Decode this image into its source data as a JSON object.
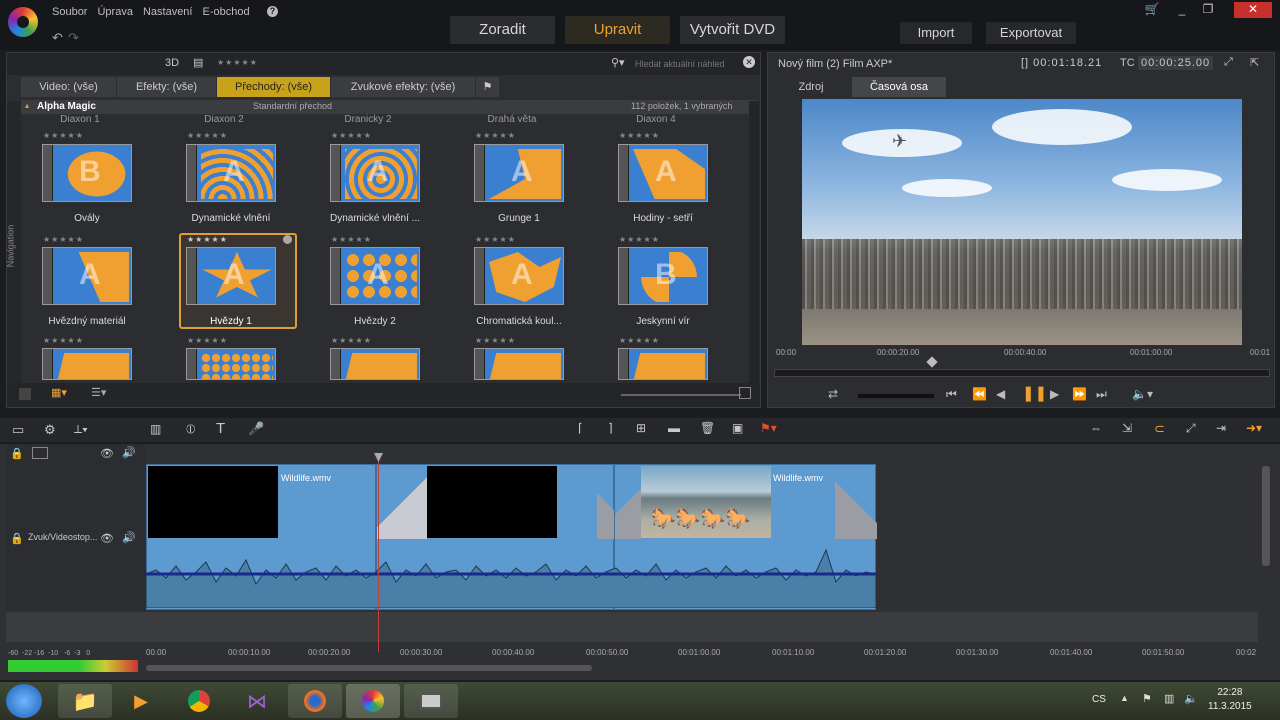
{
  "menu": {
    "items": [
      "Soubor",
      "Úprava",
      "Nastavení",
      "E-obchod"
    ]
  },
  "mode_tabs": [
    "Zoradit",
    "Upravit",
    "Vytvořit DVD"
  ],
  "actions": {
    "import": "Import",
    "export": "Exportovat"
  },
  "library": {
    "view_3d": "3D",
    "search_placeholder": "Hledat aktuální náhled",
    "filter_tabs": [
      "Video: (vše)",
      "Efekty: (vše)",
      "Přechody: (vše)",
      "Zvukové efekty: (vše)"
    ],
    "navigation_label": "Navigation",
    "group_name": "Alpha Magic",
    "group_note": "Standardní přechod",
    "group_count": "112 položek, 1 vybraných",
    "top_row_labels": [
      "Diaxon 1",
      "Diaxon 2",
      "Dranicky 2",
      "Drahá věta",
      "Diaxon 4"
    ],
    "items": [
      {
        "label": "Ovály",
        "glyph": "B"
      },
      {
        "label": "Dynamické vlnění",
        "glyph": "A"
      },
      {
        "label": "Dynamické vlnění ...",
        "glyph": "A"
      },
      {
        "label": "Grunge 1",
        "glyph": "A"
      },
      {
        "label": "Hodiny - setří",
        "glyph": "A"
      },
      {
        "label": "Hvězdný materiál",
        "glyph": "A"
      },
      {
        "label": "Hvězdy 1",
        "glyph": "A"
      },
      {
        "label": "Hvězdy 2",
        "glyph": "A"
      },
      {
        "label": "Chromatická koul...",
        "glyph": "A"
      },
      {
        "label": "Jeskynní vír",
        "glyph": "B"
      }
    ]
  },
  "player": {
    "title": "Nový film (2) Film AXP*",
    "duration": "[] 00:01:18.21",
    "tc_label": "TC",
    "tc_value": "00:00:25.00",
    "tabs": [
      "Zdroj",
      "Časová osa"
    ],
    "ruler": [
      "00:00",
      "00:00:20.00",
      "00:00:40.00",
      "00:01:00.00",
      "00:01"
    ]
  },
  "timeline": {
    "track_name": "Zvuk/Videostop...",
    "clip_name": "Wildlife.wmv",
    "ruler": [
      "00.00",
      "00:00:10.00",
      "00:00:20.00",
      "00:00:30.00",
      "00:00:40.00",
      "00:00:50.00",
      "00:01:00.00",
      "00:01:10.00",
      "00:01:20.00",
      "00:01:30.00",
      "00:01:40.00",
      "00:01:50.00",
      "00:02"
    ],
    "vu_scale": "-60  -22 -16  -10   -6  -3   0"
  },
  "taskbar": {
    "lang": "CS",
    "time": "22:28",
    "date": "11.3.2015"
  },
  "colors": {
    "accent": "#f0a030",
    "selected_tab": "#c9a21c",
    "clip": "#5d9ad0"
  }
}
